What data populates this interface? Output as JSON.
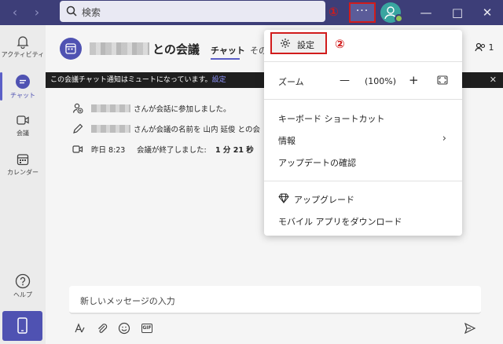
{
  "titlebar": {
    "search_placeholder": "検索",
    "more_label": "···",
    "step_markers": [
      "①",
      "②"
    ]
  },
  "rail": {
    "items": [
      {
        "label": "アクティビティ",
        "icon": "bell-icon"
      },
      {
        "label": "チャット",
        "icon": "chat-icon",
        "active": true
      },
      {
        "label": "会議",
        "icon": "video-camera-icon"
      },
      {
        "label": "カレンダー",
        "icon": "calendar-icon"
      },
      {
        "label": "ヘルプ",
        "icon": "help-icon"
      }
    ]
  },
  "chat": {
    "title": "との会議",
    "tabs": [
      "チャット",
      "その"
    ],
    "participants_count": "1",
    "notice": "この会議チャット通知はミュートになっています。",
    "notice_link": "設定",
    "events": [
      {
        "icon": "person-add-icon",
        "text": "さんが会話に参加しました。"
      },
      {
        "icon": "pencil-icon",
        "text": "さんが会議の名前を 山内 延俊 との会"
      },
      {
        "icon": "video-camera-icon",
        "time": "昨日 8:23",
        "text": "会議が終了しました: ",
        "duration": "1 分 21 秒"
      }
    ],
    "composer_placeholder": "新しいメッセージの入力"
  },
  "menu": {
    "settings": "設定",
    "zoom_label": "ズーム",
    "zoom_value": "(100%)",
    "zoom_minus": "—",
    "zoom_plus": "+",
    "shortcuts": "キーボード ショートカット",
    "about": "情報",
    "check_updates": "アップデートの確認",
    "upgrade": "アップグレード",
    "download_mobile": "モバイル アプリをダウンロード"
  },
  "colors": {
    "titlebar": "#3d3e78",
    "accent": "#5b5fc7",
    "highlight": "#d11c1c"
  }
}
